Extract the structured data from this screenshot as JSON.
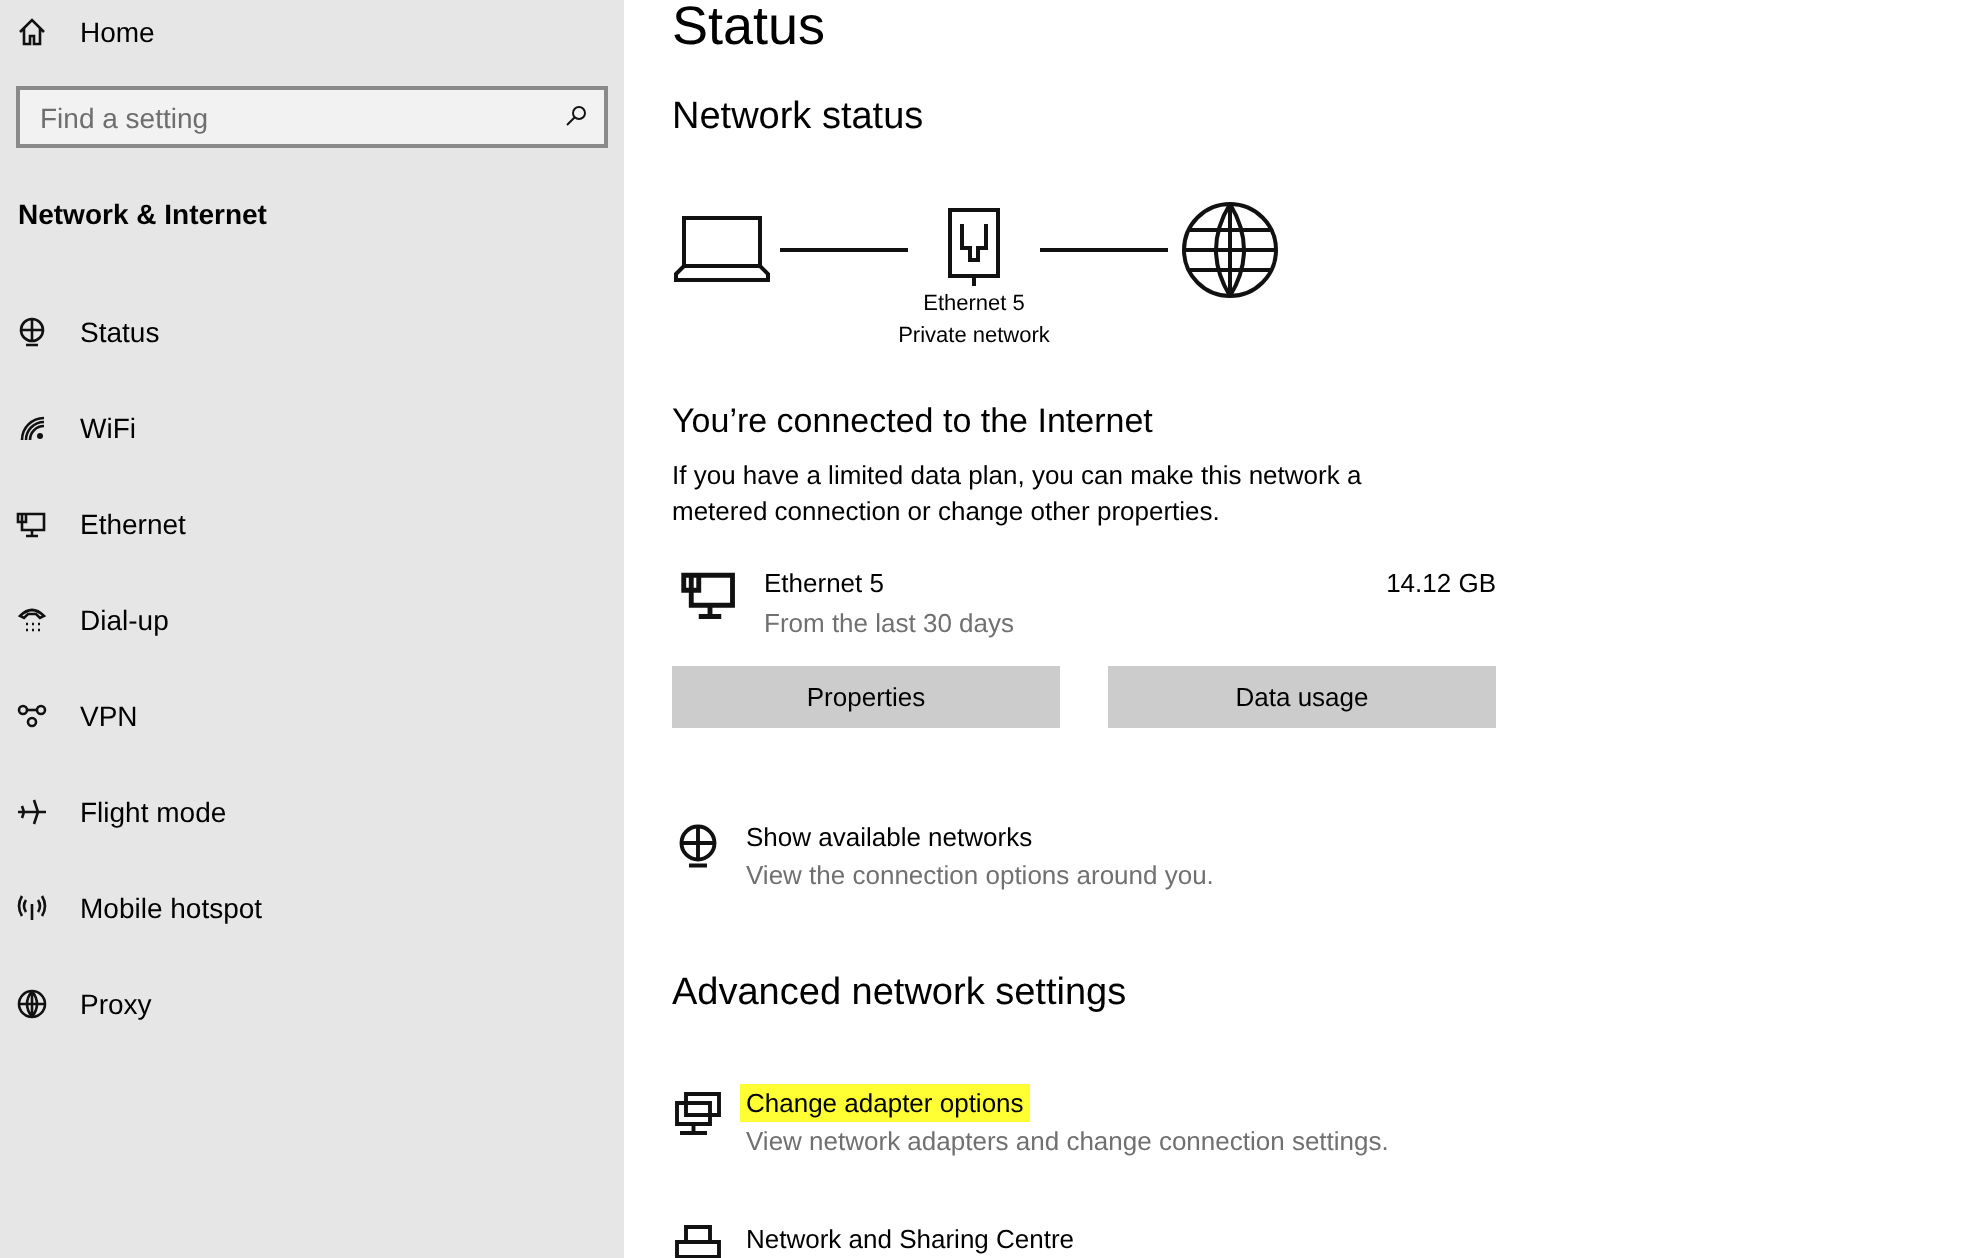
{
  "sidebar": {
    "home": "Home",
    "search": {
      "placeholder": "Find a setting"
    },
    "section_title": "Network & Internet",
    "items": [
      {
        "label": "Status",
        "kind": "status"
      },
      {
        "label": "WiFi",
        "kind": "wifi"
      },
      {
        "label": "Ethernet",
        "kind": "ethernet"
      },
      {
        "label": "Dial-up",
        "kind": "dialup"
      },
      {
        "label": "VPN",
        "kind": "vpn"
      },
      {
        "label": "Flight mode",
        "kind": "flight"
      },
      {
        "label": "Mobile hotspot",
        "kind": "hotspot"
      },
      {
        "label": "Proxy",
        "kind": "proxy"
      }
    ]
  },
  "main": {
    "title": "Status",
    "network_status": {
      "heading": "Network status",
      "adapter_name": "Ethernet 5",
      "network_type": "Private network"
    },
    "connection": {
      "heading": "You’re connected to the Internet",
      "description": "If you have a limited data plan, you can make this network a metered connection or change other properties.",
      "adapter": {
        "name": "Ethernet 5",
        "period": "From the last 30 days",
        "usage": "14.12 GB"
      },
      "buttons": [
        "Properties",
        "Data usage"
      ]
    },
    "show_networks": {
      "title": "Show available networks",
      "description": "View the connection options around you."
    },
    "advanced": {
      "heading": "Advanced network settings",
      "links": [
        {
          "kind": "adapter",
          "title": "Change adapter options",
          "description": "View network adapters and change connection settings.",
          "highlighted": true
        },
        {
          "kind": "sharing",
          "title": "Network and Sharing Centre",
          "highlighted": false
        }
      ]
    }
  }
}
